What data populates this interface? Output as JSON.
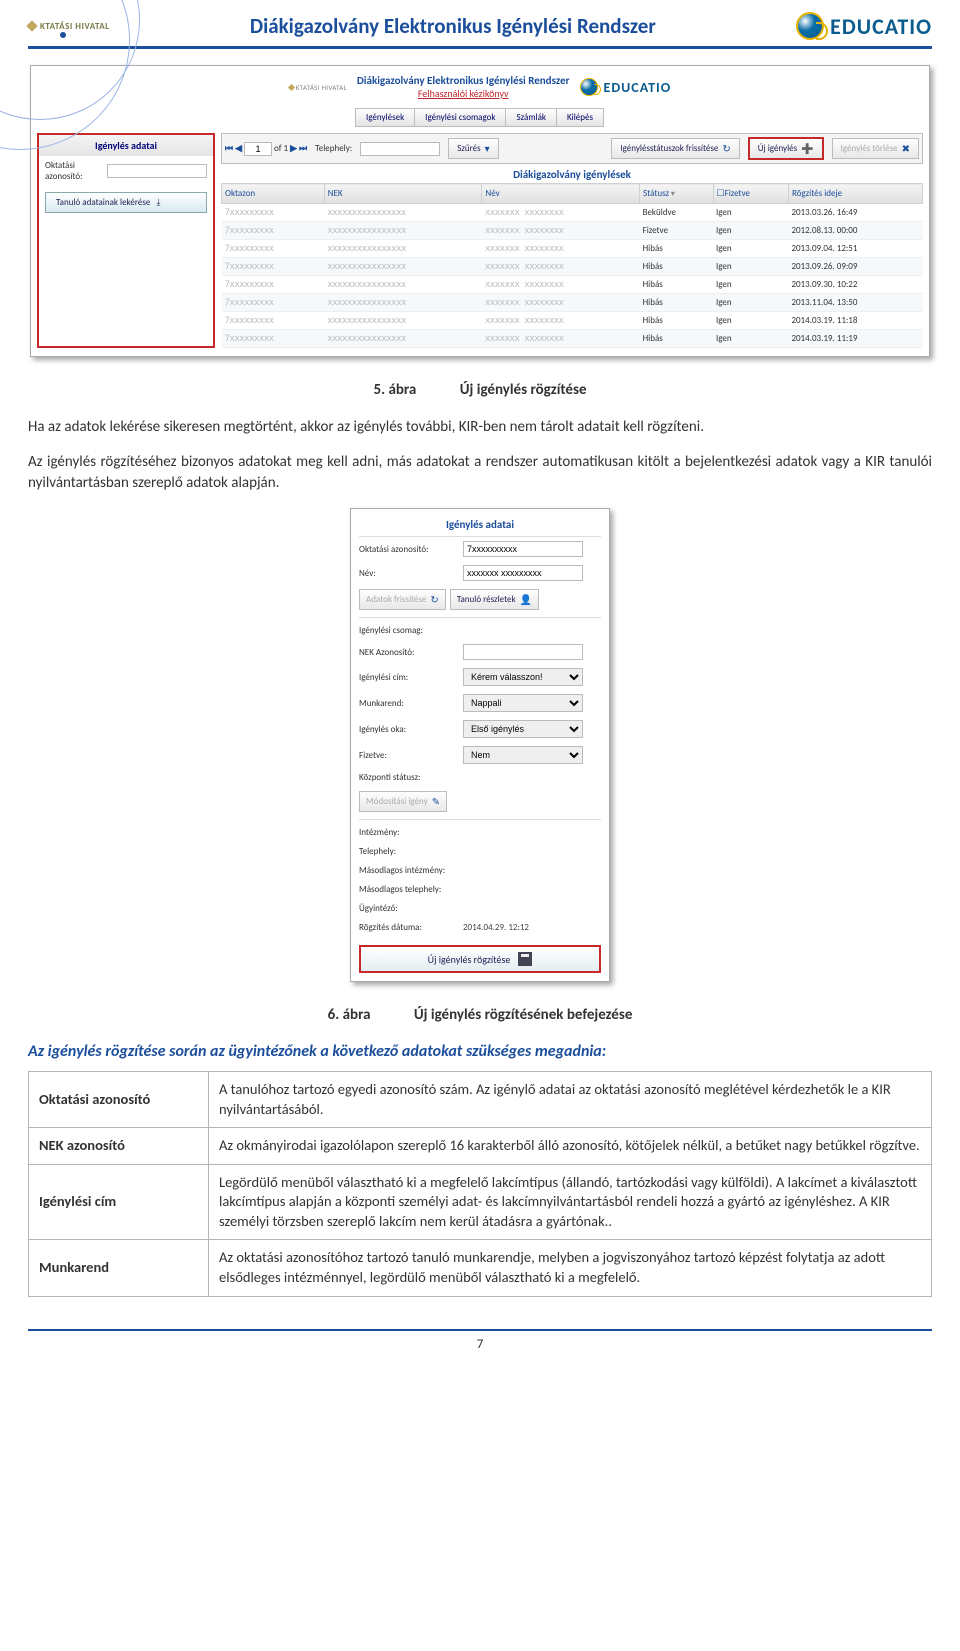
{
  "header": {
    "left_logo_text": "KTATÁSI HIVATAL",
    "title": "Diákigazolvány Elektronikus Igénylési Rendszer",
    "right_logo_text": "EDUCATIO"
  },
  "ss1": {
    "app_title": "Diákigazolvány Elektronikus Igénylési Rendszer",
    "app_subtitle": "Felhasználói kézikönyv",
    "tabs": [
      "Igénylések",
      "Igénylési csomagok",
      "Számlák",
      "Kilépés"
    ],
    "left": {
      "panel_title": "Igénylés adatai",
      "field_label": "Oktatási azonosító:",
      "lekeres_button": "Tanuló adatainak lekérése"
    },
    "toolbar": {
      "pager_of": "of",
      "pager_page": "1",
      "pager_total": "1",
      "telephely_label": "Telephely:",
      "szures_label": "Szűrés",
      "statuszok_label": "Igénylésstátuszok frissítése",
      "uj_igenyles_label": "Új igénylés",
      "torles_label": "Igénylés törlése"
    },
    "table_title": "Diákigazolvány igénylések",
    "columns": [
      "Oktazon",
      "NEK",
      "Név",
      "Státusz",
      "Fizetve",
      "Rögzítés ideje"
    ],
    "sort_icon_col": 3,
    "rows": [
      {
        "status": "Beküldve",
        "fizetve": "Igen",
        "rogz": "2013.03.26. 16:49"
      },
      {
        "status": "Fizetve",
        "fizetve": "Igen",
        "rogz": "2012.08.13. 00:00"
      },
      {
        "status": "Hibás",
        "fizetve": "Igen",
        "rogz": "2013.09.04. 12:51"
      },
      {
        "status": "Hibás",
        "fizetve": "Igen",
        "rogz": "2013.09.26. 09:09"
      },
      {
        "status": "Hibás",
        "fizetve": "Igen",
        "rogz": "2013.09.30. 10:22"
      },
      {
        "status": "Hibás",
        "fizetve": "Igen",
        "rogz": "2013.11.04. 13:50"
      },
      {
        "status": "Hibás",
        "fizetve": "Igen",
        "rogz": "2014.03.19. 11:18"
      },
      {
        "status": "Hibás",
        "fizetve": "Igen",
        "rogz": "2014.03.19. 11:19"
      }
    ]
  },
  "caption1": {
    "num": "5. ábra",
    "text": "Új igénylés rögzítése"
  },
  "para1": "Ha az adatok lekérése sikeresen megtörtént, akkor az igénylés további, KIR-ben nem tárolt adatait kell rögzíteni.",
  "para2": "Az igénylés rögzítéséhez bizonyos adatokat meg kell adni, más adatokat a rendszer automatikusan kitölt a bejelentkezési adatok vagy a KIR tanulói nyilvántartásban szereplő adatok alapján.",
  "ss2": {
    "title": "Igénylés adatai",
    "rows": [
      {
        "label": "Oktatási azonosító:",
        "type": "input",
        "value": "7xxxxxxxxxx"
      },
      {
        "label": "Név:",
        "type": "input",
        "value": "xxxxxxx xxxxxxxxx"
      }
    ],
    "btn_frissit": "Adatok frissítése",
    "btn_reszletek": "Tanuló részletek",
    "rows2": [
      {
        "label": "Igénylési csomag:",
        "type": "text",
        "value": ""
      },
      {
        "label": "NEK Azonosító:",
        "type": "input",
        "value": ""
      },
      {
        "label": "Igénylési cím:",
        "type": "select",
        "value": "Kérem válasszon!"
      },
      {
        "label": "Munkarend:",
        "type": "select",
        "value": "Nappali"
      },
      {
        "label": "Igénylés oka:",
        "type": "select",
        "value": "Első igénylés"
      },
      {
        "label": "Fizetve:",
        "type": "select",
        "value": "Nem"
      },
      {
        "label": "Központi státusz:",
        "type": "text",
        "value": ""
      }
    ],
    "btn_modositasi": "Módosítási igény",
    "rows3": [
      {
        "label": "Intézmény:",
        "type": "text",
        "value": ""
      },
      {
        "label": "Telephely:",
        "type": "text",
        "value": ""
      },
      {
        "label": "Másodlagos intézmény:",
        "type": "text",
        "value": ""
      },
      {
        "label": "Másodlagos telephely:",
        "type": "text",
        "value": ""
      },
      {
        "label": "Ügyintéző:",
        "type": "text",
        "value": ""
      },
      {
        "label": "Rögzítés dátuma:",
        "type": "text",
        "value": "2014.04.29. 12:12"
      }
    ],
    "save_label": "Új igénylés rögzítése"
  },
  "caption2": {
    "num": "6. ábra",
    "text": "Új igénylés rögzítésének befejezése"
  },
  "blue_heading": "Az igénylés rögzítése során az ügyintézőnek a következő adatokat szükséges megadnia:",
  "fields_table": [
    {
      "name": "Oktatási azonosító",
      "desc": "A tanulóhoz tartozó egyedi azonosító szám. Az igénylő adatai az oktatási azonosító meglétével kérdezhetők le a KIR nyilvántartásából."
    },
    {
      "name": "NEK azonosító",
      "desc": "Az okmányirodai igazolólapon szereplő 16 karakterből álló azonosító, kötőjelek nélkül, a betűket nagy betűkkel rögzítve."
    },
    {
      "name": "Igénylési cím",
      "desc": "Legördülő menüből választható ki a megfelelő lakcímtípus (állandó, tartózkodási vagy külföldi). A lakcímet a kiválasztott lakcímtípus alapján a központi személyi adat- és lakcímnyilvántartásból rendeli hozzá a gyártó az igényléshez. A KIR személyi törzsben szereplő lakcím nem kerül átadásra a gyártónak.."
    },
    {
      "name": "Munkarend",
      "desc": "Az oktatási azonosítóhoz tartozó tanuló munkarendje, melyben a jogviszonyához tartozó képzést folytatja az adott elsődleges intézménnyel, legördülő menüből választható ki a megfelelő."
    }
  ],
  "page_number": "7"
}
